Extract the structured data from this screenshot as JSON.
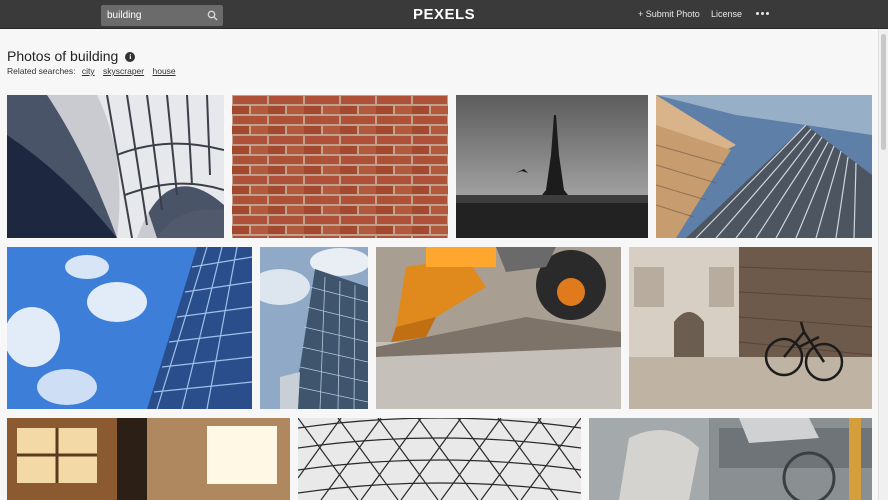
{
  "header": {
    "search_value": "building",
    "logo_text": "PEXELS",
    "submit_label": "+ Submit Photo",
    "license_label": "License"
  },
  "page": {
    "title": "Photos of building",
    "related_label": "Related searches:",
    "related_searches": [
      "city",
      "skyscraper",
      "house"
    ]
  },
  "photos": {
    "row1": [
      "library-curved-glass-photo",
      "red-brick-wall-photo",
      "eiffel-tower-bw-photo",
      "glass-skyscraper-lowangle-photo"
    ],
    "row2": [
      "blue-sky-glass-facade-photo",
      "reflective-tower-photo",
      "bulldozer-wheel-photo",
      "archway-bicycle-photo"
    ],
    "row3": [
      "brick-interior-windows-photo",
      "glass-dome-lattice-photo",
      "bicycle-closeup-photo"
    ]
  }
}
